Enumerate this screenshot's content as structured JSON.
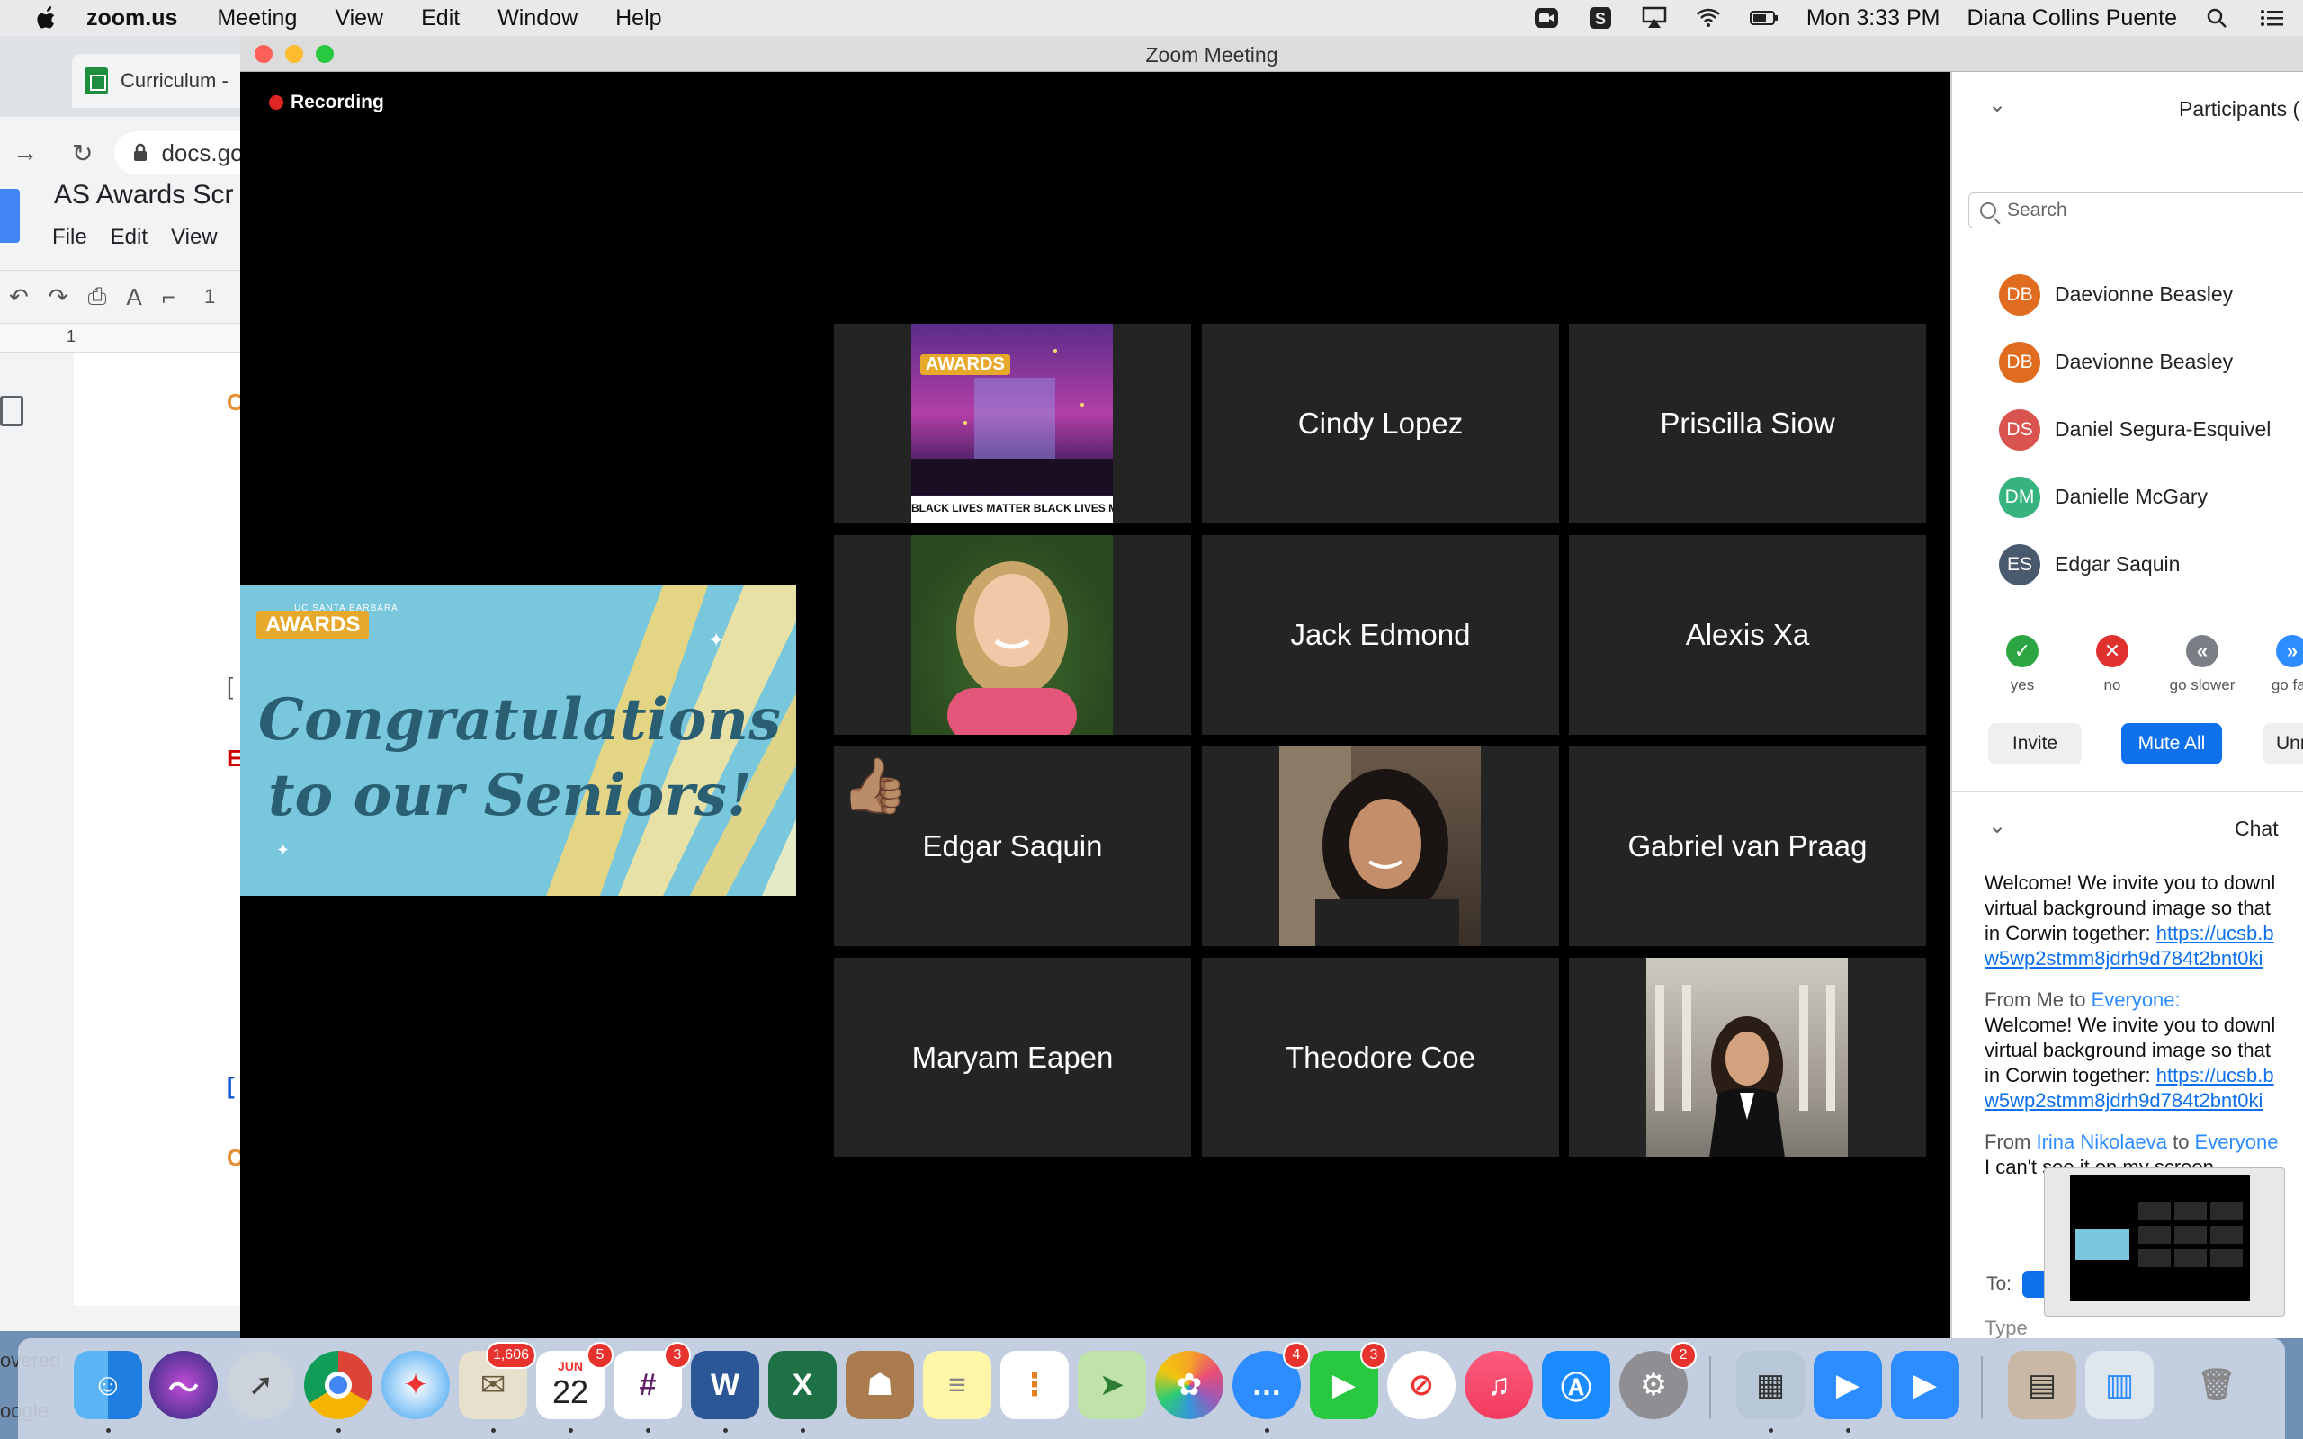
{
  "menubar": {
    "app": "zoom.us",
    "items": [
      "Meeting",
      "View",
      "Edit",
      "Window",
      "Help"
    ],
    "clock": "Mon 3:33 PM",
    "user": "Diana Collins Puente"
  },
  "docs": {
    "tab_title": "Curriculum -",
    "url": "docs.go",
    "doc_title": "AS Awards Scr",
    "menu": [
      "File",
      "Edit",
      "View"
    ],
    "ruler_num": "1",
    "toolbar_num": "1",
    "frag1": "C",
    "frag2": "[",
    "frag3": "E",
    "frag4": "[",
    "frag5": "C",
    "bottom1": "overed",
    "bottom2": "oogle"
  },
  "zoom": {
    "window_title": "Zoom Meeting",
    "recording": "Recording",
    "share": {
      "badge": "AWARDS",
      "small": "UC SANTA BARBARA",
      "line1": "Congratulations",
      "line2": "to our Seniors!"
    },
    "awards_banner": {
      "badge": "AWARDS",
      "caption": "BLACK LIVES MATTER   BLACK LIVES M"
    },
    "tiles": [
      {
        "name": "Cindy Lopez"
      },
      {
        "name": "Priscilla Siow"
      },
      {
        "name": "Jack Edmond"
      },
      {
        "name": "Alexis Xa"
      },
      {
        "name": "Edgar Saquin"
      },
      {
        "name": "Gabriel van Praag"
      },
      {
        "name": "Maryam Eapen"
      },
      {
        "name": "Theodore Coe"
      }
    ],
    "reaction_emoji": "👍🏽"
  },
  "panel": {
    "title": "Participants (",
    "search_placeholder": "Search",
    "participants": [
      {
        "initials": "DB",
        "name": "Daevionne Beasley",
        "color": "#e06c1f"
      },
      {
        "initials": "DB",
        "name": "Daevionne Beasley",
        "color": "#e06c1f"
      },
      {
        "initials": "DS",
        "name": "Daniel Segura-Esquivel",
        "color": "#d9534f"
      },
      {
        "initials": "DM",
        "name": "Danielle McGary",
        "color": "#36b37e"
      },
      {
        "initials": "ES",
        "name": "Edgar Saquin",
        "color": "#4a5a6e"
      }
    ],
    "reactions": [
      {
        "label": "yes",
        "symbol": "✓",
        "color": "#2ca543"
      },
      {
        "label": "no",
        "symbol": "✕",
        "color": "#e0312f"
      },
      {
        "label": "go slower",
        "symbol": "«",
        "color": "#7a7f86"
      },
      {
        "label": "go fas",
        "symbol": "»",
        "color": "#2d8cff"
      }
    ],
    "buttons": {
      "invite": "Invite",
      "mute_all": "Mute All",
      "unmute": "Unm"
    },
    "chat_title": "Chat",
    "chat": {
      "m1_l1": "Welcome! We invite you to downl",
      "m1_l2": "virtual background image so that",
      "m1_l3": "in Corwin together: ",
      "m1_link1": "https://ucsb.b",
      "m1_link2": "w5wp2stmm8jdrh9d784t2bnt0ki",
      "m2_from": "From Me to ",
      "m2_to": "Everyone:",
      "m2_l1": "Welcome! We invite you to downl",
      "m2_l2": "virtual background image so that",
      "m2_l3": "in Corwin together: ",
      "m2_link1": "https://ucsb.b",
      "m2_link2": "w5wp2stmm8jdrh9d784t2bnt0ki",
      "m3_from": "From ",
      "m3_sender": "Irina Nikolaeva",
      "m3_to_word": " to ",
      "m3_to": "Everyone",
      "m3_l1": "I can't see it on my screen"
    },
    "to_label": "To:",
    "type_placeholder": "Type"
  },
  "dock": {
    "badges": {
      "mail": "1,606",
      "calendar": "5",
      "slack": "3",
      "messages": "4",
      "facetime": "3",
      "prefs": "2"
    },
    "calendar_month": "JUN",
    "calendar_day": "22",
    "word": "W",
    "excel": "X"
  }
}
